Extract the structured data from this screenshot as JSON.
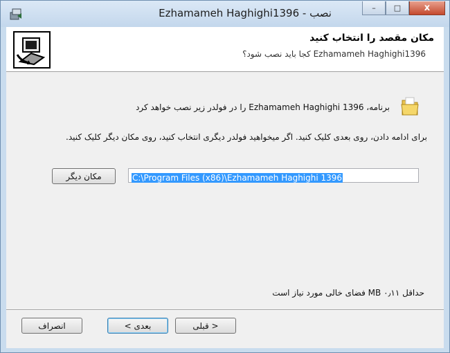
{
  "window": {
    "title": "نصب - Ezhamameh Haghighi1396",
    "close_glyph": "x",
    "min_glyph": "–",
    "max_glyph": "□"
  },
  "header": {
    "title": "مکان مقصد را انتخاب کنید",
    "subtitle": "Ezhamameh Haghighi1396 کجا باید نصب شود؟"
  },
  "body": {
    "info_line": "برنامه، Ezhamameh Haghighi 1396 را در فولدر زیر نصب خواهد کرد",
    "instruction": "برای ادامه دادن، روی بعدی کلیک کنید. اگر میخواهید فولدر دیگری انتخاب کنید، روی مکان دیگر کلیک کنید.",
    "path_value": "C:\\Program Files (x86)\\Ezhamameh Haghighi 1396",
    "browse_label": "مکان دیگر",
    "space_required": "حداقل ۰٫۱۱ MB فضای خالی مورد نیاز است"
  },
  "footer": {
    "back_label": "< قبلی",
    "next_label": "بعدی >",
    "cancel_label": "انصراف"
  }
}
